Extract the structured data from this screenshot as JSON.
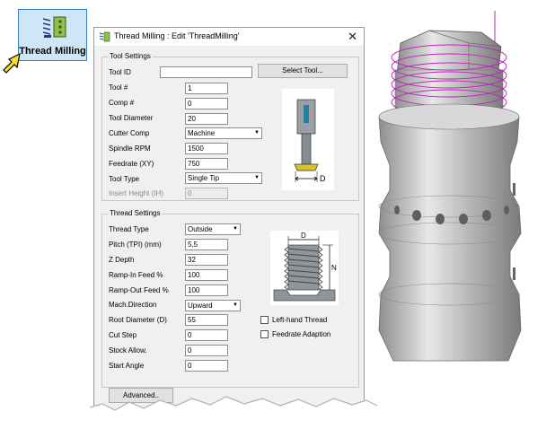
{
  "launcher": {
    "label": "Thread Milling",
    "icon": "thread-mill-icon"
  },
  "dialog": {
    "title": "Thread Milling : Edit 'ThreadMilling'",
    "close": "✕",
    "tool_settings": {
      "title": "Tool Settings",
      "select_tool_label": "Select Tool...",
      "fields": [
        {
          "label": "Tool ID",
          "value": ""
        },
        {
          "label": "Tool #",
          "value": "1"
        },
        {
          "label": "Comp #",
          "value": "0"
        },
        {
          "label": "Tool Diameter",
          "value": "20"
        },
        {
          "label": "Cutter Comp",
          "value": "Machine"
        },
        {
          "label": "Spindle RPM",
          "value": "1500"
        },
        {
          "label": "Feedrate (XY)",
          "value": "750"
        },
        {
          "label": "Tool Type",
          "value": "Single Tip"
        },
        {
          "label": "Insert Height (IH)",
          "value": "0"
        }
      ],
      "diagram_label": "D"
    },
    "thread_settings": {
      "title": "Thread Settings",
      "fields": [
        {
          "label": "Thread Type",
          "value": "Outside"
        },
        {
          "label": "Pitch (TPI) (mm)",
          "value": "5,5"
        },
        {
          "label": "Z Depth",
          "value": "32"
        },
        {
          "label": "Ramp-In Feed %",
          "value": "100"
        },
        {
          "label": "Ramp-Out Feed %",
          "value": "100"
        },
        {
          "label": "Mach.Direction",
          "value": "Upward"
        },
        {
          "label": "Root Diameter (D)",
          "value": "55"
        },
        {
          "label": "Cut Step",
          "value": "0"
        },
        {
          "label": "Stock Allow.",
          "value": "0"
        },
        {
          "label": "Start Angle",
          "value": "0"
        }
      ],
      "checkboxes": [
        {
          "label": "Left-hand Thread",
          "checked": false
        },
        {
          "label": "Feedrate Adaption",
          "checked": false
        }
      ],
      "diagram_labels": {
        "d": "D",
        "n": "N"
      }
    },
    "advanced_label": "Advanced.."
  }
}
